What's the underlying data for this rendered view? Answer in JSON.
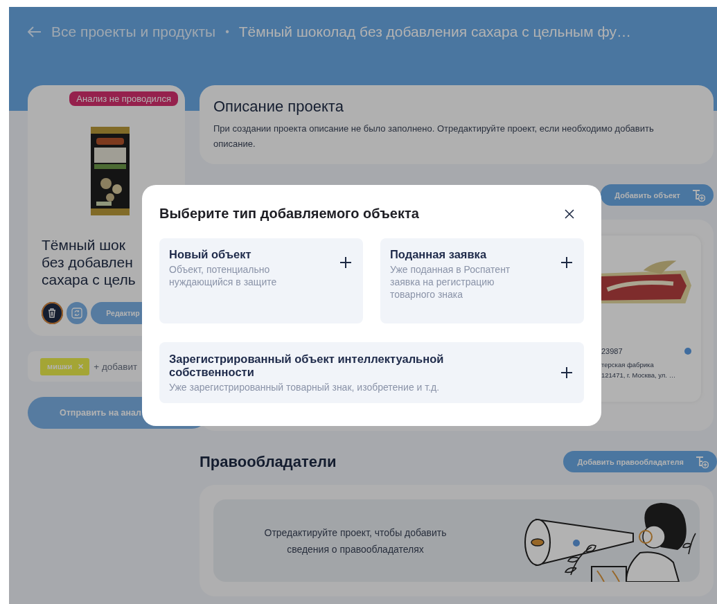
{
  "breadcrumb": {
    "parent": "Все проекты и продукты",
    "separator": "•",
    "current": "Тёмный шоколад без добавления сахара с цельным фу…"
  },
  "project_card": {
    "badge": "Анализ не проводился",
    "title_lines": [
      "Тёмный шок",
      "без добавлен",
      "сахара с цель"
    ],
    "edit_button": "Редактир",
    "tags": [
      {
        "label": "мишки",
        "remove": "✕",
        "color": "#a4a535"
      }
    ],
    "add_tag": "+ добавит",
    "send_button": "Отправить на анал"
  },
  "description": {
    "title": "Описание проекта",
    "text": "При создании проекта описание не было заполнено. Отредактируйте проект, если необходимо добавить описание."
  },
  "objects": {
    "add_button": "Добавить объект",
    "items": [
      {
        "number": "23987",
        "owner": "терская фабрика",
        "address": "121471, г. Москва, ул. …",
        "color": "#3f6c9e"
      }
    ]
  },
  "holders": {
    "title": "Правообладатели",
    "add_button": "Добавить правообладателя",
    "empty_text": "Отредактируйте проект, чтобы добавить сведения о правообладателях"
  },
  "modal": {
    "title": "Выберите тип добавляемого объекта",
    "options": [
      {
        "title": "Новый объект",
        "text": "Объект, потенциально нуждающийся в защите"
      },
      {
        "title": "Поданная заявка",
        "text": "Уже поданная в Роспатент заявка на регистрацию товарного знака"
      },
      {
        "title": "Зарегистрированный объект интеллектуальной собственности",
        "text": "Уже зарегистрированный товарный знак, изобретение и т.д."
      }
    ]
  }
}
